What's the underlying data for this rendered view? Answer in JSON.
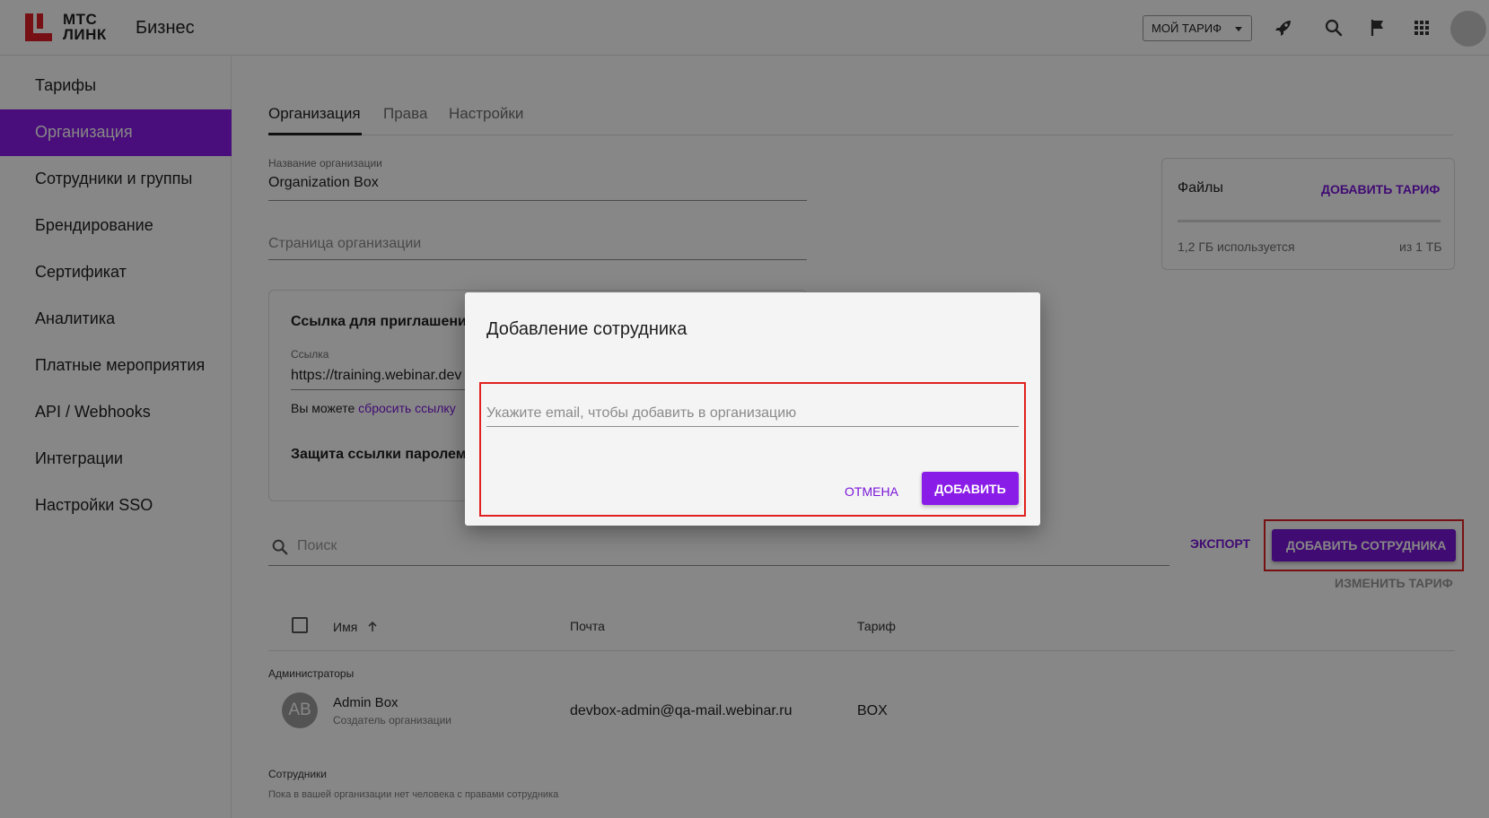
{
  "header": {
    "logo_line1": "МТС",
    "logo_line2": "ЛИНК",
    "brand": "Бизнес",
    "plan_button": "МОЙ ТАРИФ"
  },
  "sidebar": {
    "items": [
      {
        "label": "Тарифы"
      },
      {
        "label": "Организация",
        "active": true
      },
      {
        "label": "Сотрудники и группы"
      },
      {
        "label": "Брендирование"
      },
      {
        "label": "Сертификат"
      },
      {
        "label": "Аналитика"
      },
      {
        "label": "Платные мероприятия"
      },
      {
        "label": "API / Webhooks"
      },
      {
        "label": "Интеграции"
      },
      {
        "label": "Настройки SSO"
      }
    ]
  },
  "tabs": [
    "Организация",
    "Права",
    "Настройки"
  ],
  "org": {
    "name_label": "Название организации",
    "name_value": "Organization Box",
    "page_placeholder": "Страница организации"
  },
  "invite": {
    "title": "Ссылка для приглашения",
    "link_label": "Ссылка",
    "link_value": "https://training.webinar.dev",
    "reset_prefix": "Вы можете ",
    "reset_link": "сбросить ссылку",
    "password_title": "Защита ссылки паролем"
  },
  "files": {
    "title": "Файлы",
    "add_plan": "ДОБАВИТЬ ТАРИФ",
    "used": "1,2 ГБ используется",
    "total": "из 1 ТБ"
  },
  "toolbar": {
    "search_placeholder": "Поиск",
    "export": "ЭКСПОРТ",
    "add_employee": "ДОБАВИТЬ СОТРУДНИКА",
    "change_plan": "ИЗМЕНИТЬ ТАРИФ"
  },
  "table": {
    "col_name": "Имя",
    "col_email": "Почта",
    "col_plan": "Тариф",
    "admins_label": "Администраторы",
    "admin": {
      "initials": "AB",
      "name": "Admin Box",
      "role": "Создатель организации",
      "email": "devbox-admin@qa-mail.webinar.ru",
      "plan": "BOX"
    },
    "employees_label": "Сотрудники",
    "employees_empty": "Пока в вашей организации нет человека с правами сотрудника"
  },
  "dialog": {
    "title": "Добавление сотрудника",
    "email_placeholder": "Укажите email, чтобы добавить в организацию",
    "email_value": "",
    "cancel": "ОТМЕНА",
    "add": "ДОБАВИТЬ"
  },
  "colors": {
    "accent": "#8a1ce8",
    "logo_red": "#e11f26",
    "highlight": "#e12020"
  }
}
